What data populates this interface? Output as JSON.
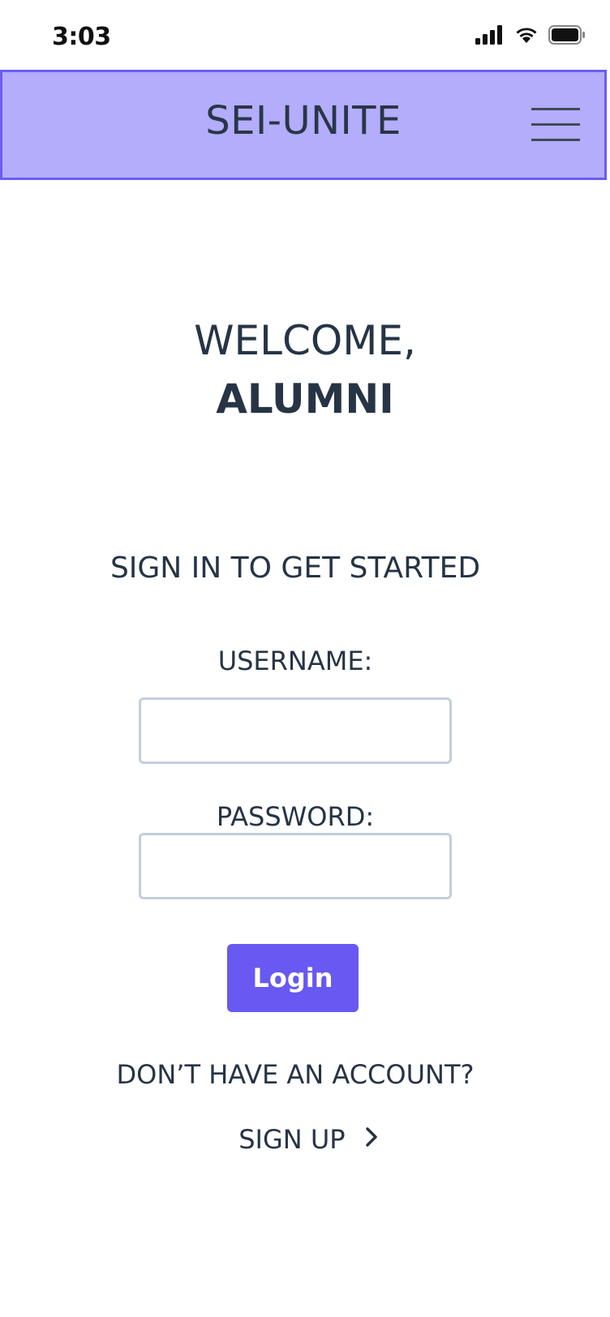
{
  "status_bar": {
    "time": "3:03",
    "icons": [
      "cellular-signal-icon",
      "wifi-icon",
      "battery-icon"
    ]
  },
  "header": {
    "brand": "SEI-UNITE",
    "menu_icon": "hamburger-menu-icon",
    "background_color": "#b3adfb",
    "border_color": "#6b5df1"
  },
  "welcome": {
    "line1": "WELCOME,",
    "line2": "ALUMNI"
  },
  "signin": {
    "heading": "SIGN IN TO GET STARTED",
    "username_label": "USERNAME:",
    "username_value": "",
    "password_label": "PASSWORD:",
    "password_value": "",
    "login_label": "Login",
    "login_color": "#6759f1"
  },
  "signup": {
    "prompt": "DON’T HAVE AN ACCOUNT?",
    "link_label": "SIGN UP",
    "link_icon": "chevron-right-icon"
  }
}
